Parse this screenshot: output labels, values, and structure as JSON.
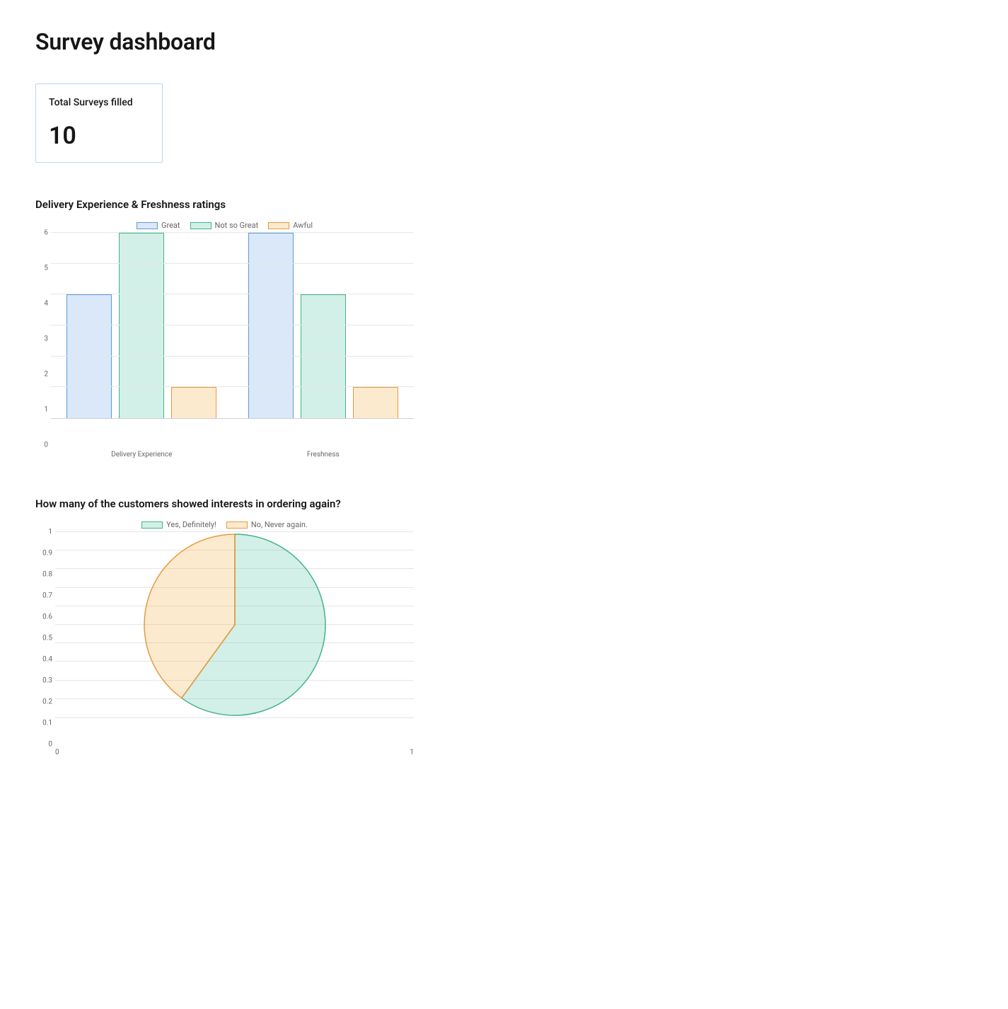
{
  "page": {
    "title": "Survey dashboard"
  },
  "summary_card": {
    "label": "Total Surveys filled",
    "value": "10"
  },
  "bar_section": {
    "title": "Delivery Experience & Freshness ratings"
  },
  "pie_section": {
    "title": "How many of the customers showed interests in ordering again?"
  },
  "chart_data": [
    {
      "type": "bar",
      "title": "Delivery Experience & Freshness ratings",
      "categories": [
        "Delivery Experience",
        "Freshness"
      ],
      "series": [
        {
          "name": "Great",
          "values": [
            4,
            6
          ],
          "fill": "rgba(106,163,231,0.25)",
          "stroke": "#5b9bd5"
        },
        {
          "name": "Not so Great",
          "values": [
            6,
            4
          ],
          "fill": "rgba(76,194,160,0.25)",
          "stroke": "#43b28f"
        },
        {
          "name": "Awful",
          "values": [
            1,
            1
          ],
          "fill": "rgba(242,170,62,0.25)",
          "stroke": "#e8993e"
        }
      ],
      "ylim": [
        0,
        6
      ],
      "yticks": [
        0,
        1,
        2,
        3,
        4,
        5,
        6
      ],
      "xlabel": "",
      "ylabel": ""
    },
    {
      "type": "pie",
      "title": "How many of the customers showed interests in ordering again?",
      "series": [
        {
          "name": "Yes, Definitely!",
          "value": 6,
          "fill": "rgba(76,194,160,0.25)",
          "stroke": "#43b28f"
        },
        {
          "name": "No, Never again.",
          "value": 4,
          "fill": "rgba(242,170,62,0.25)",
          "stroke": "#e8993e"
        }
      ],
      "axis_ticks_y": [
        0,
        0.1,
        0.2,
        0.3,
        0.4,
        0.5,
        0.6,
        0.7,
        0.8,
        0.9,
        1
      ],
      "axis_ticks_x": [
        "0",
        "1"
      ]
    }
  ]
}
